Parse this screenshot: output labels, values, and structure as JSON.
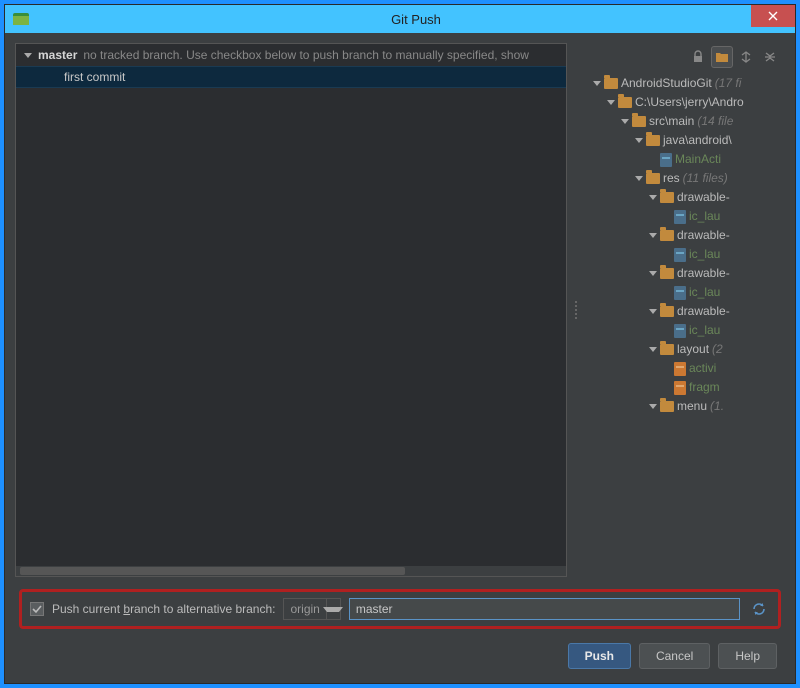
{
  "window": {
    "title": "Git Push"
  },
  "branch": {
    "name": "master",
    "hint": "no tracked branch. Use checkbox below to push branch to manually specified, show"
  },
  "commits": [
    "first commit"
  ],
  "tree": [
    {
      "label": "AndroidStudioGit",
      "dim": "(17 fi",
      "indent": 1,
      "icon": "folder"
    },
    {
      "label": "C:\\Users\\jerry\\Andro",
      "dim": "",
      "indent": 2,
      "icon": "folder"
    },
    {
      "label": "src\\main",
      "dim": "(14 file",
      "indent": 3,
      "icon": "folder"
    },
    {
      "label": "java\\android\\",
      "dim": "",
      "indent": 4,
      "icon": "folder"
    },
    {
      "label": "MainActi",
      "dim": "",
      "indent": 5,
      "icon": "file",
      "green": true,
      "noarrow": true
    },
    {
      "label": "res",
      "dim": "(11 files)",
      "indent": 4,
      "icon": "folder"
    },
    {
      "label": "drawable-",
      "dim": "",
      "indent": 5,
      "icon": "folder"
    },
    {
      "label": "ic_lau",
      "dim": "",
      "indent": 6,
      "icon": "file",
      "green": true,
      "noarrow": true
    },
    {
      "label": "drawable-",
      "dim": "",
      "indent": 5,
      "icon": "folder"
    },
    {
      "label": "ic_lau",
      "dim": "",
      "indent": 6,
      "icon": "file",
      "green": true,
      "noarrow": true
    },
    {
      "label": "drawable-",
      "dim": "",
      "indent": 5,
      "icon": "folder"
    },
    {
      "label": "ic_lau",
      "dim": "",
      "indent": 6,
      "icon": "file",
      "green": true,
      "noarrow": true
    },
    {
      "label": "drawable-",
      "dim": "",
      "indent": 5,
      "icon": "folder"
    },
    {
      "label": "ic_lau",
      "dim": "",
      "indent": 6,
      "icon": "file",
      "green": true,
      "noarrow": true
    },
    {
      "label": "layout",
      "dim": "(2",
      "indent": 5,
      "icon": "folder"
    },
    {
      "label": "activi",
      "dim": "",
      "indent": 6,
      "icon": "ofile",
      "green": true,
      "noarrow": true
    },
    {
      "label": "fragm",
      "dim": "",
      "indent": 6,
      "icon": "ofile",
      "green": true,
      "noarrow": true
    },
    {
      "label": "menu",
      "dim": "(1.",
      "indent": 5,
      "icon": "folder"
    }
  ],
  "altPush": {
    "label_pre": "Push current ",
    "label_u": "b",
    "label_post": "ranch to alternative branch:",
    "remote": "origin",
    "branch": "master",
    "checked": true
  },
  "buttons": {
    "push": "Push",
    "cancel": "Cancel",
    "help": "Help"
  }
}
